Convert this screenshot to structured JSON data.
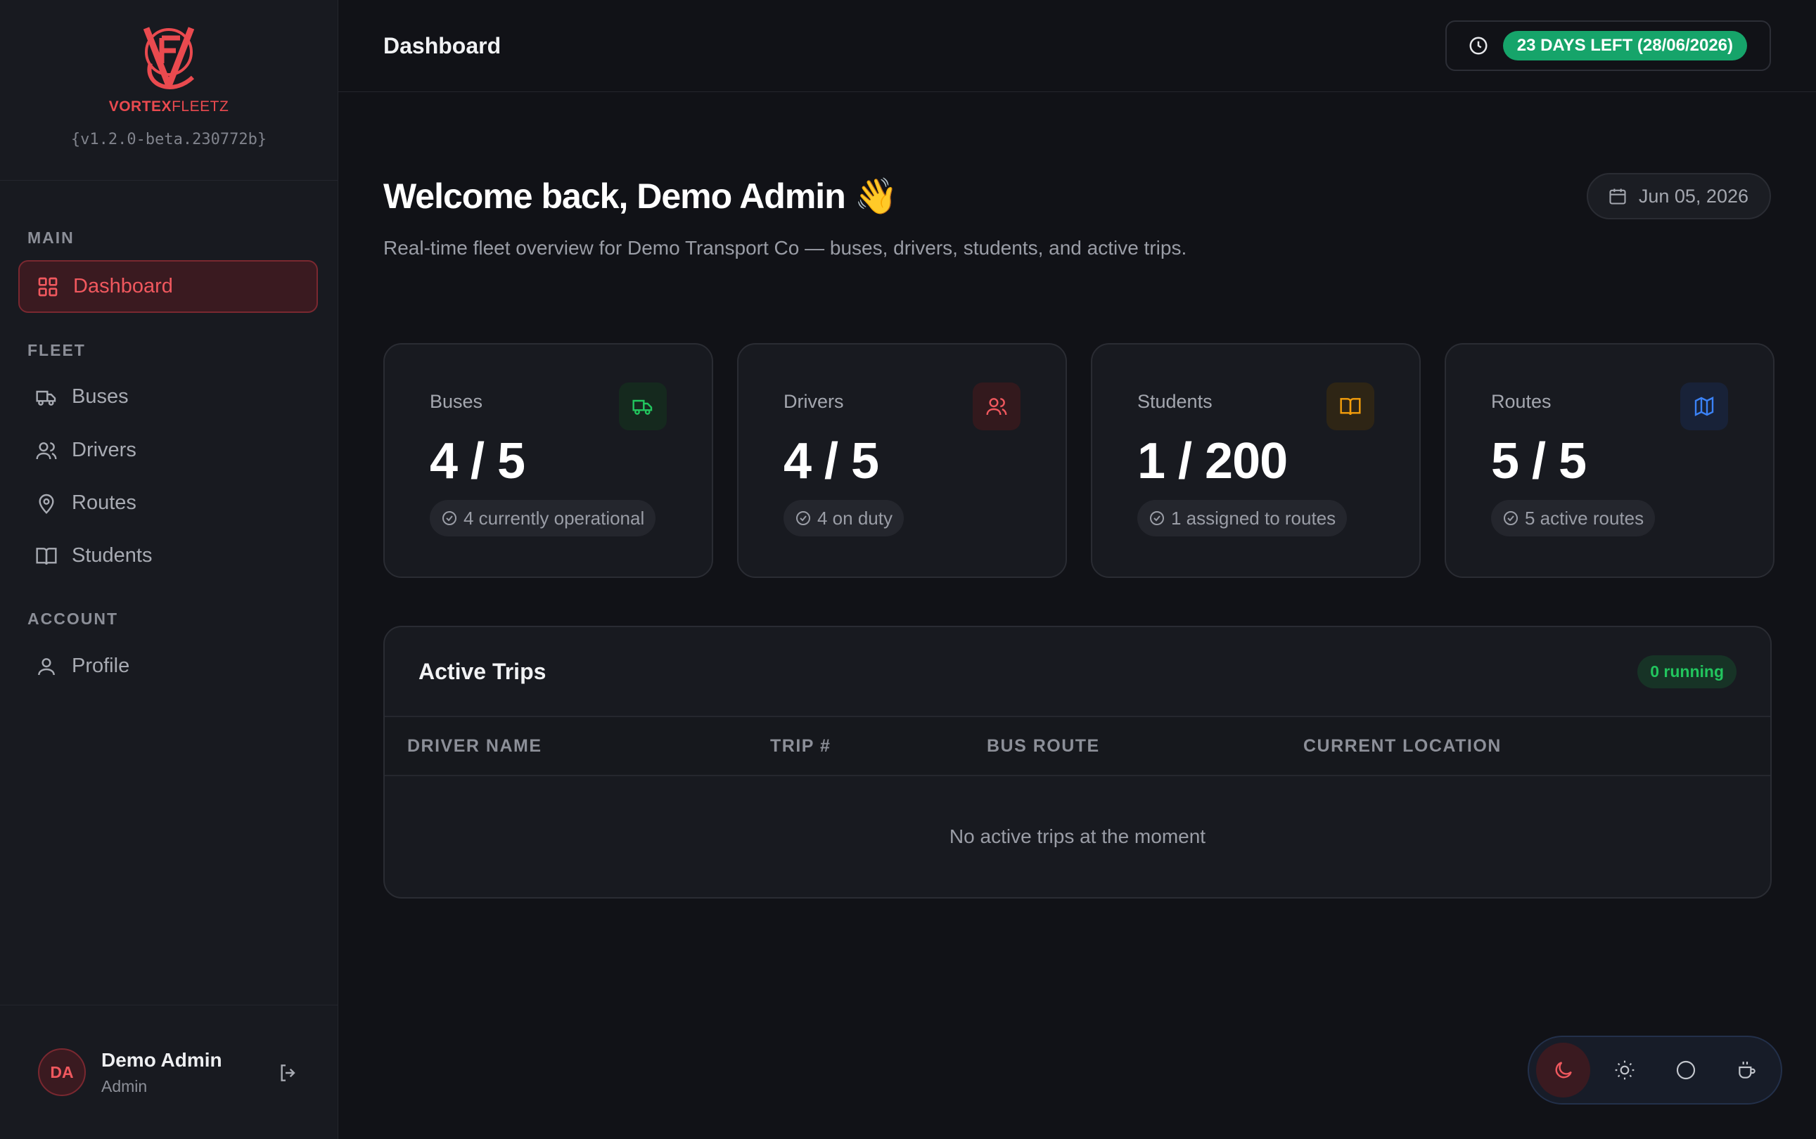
{
  "brand": {
    "name_bold": "VORTEX",
    "name_light": "FLEET",
    "suffix": "Z",
    "version": "{v1.2.0-beta.230772b}",
    "accent_color": "#ea4a4f"
  },
  "sidebar": {
    "sections": [
      {
        "title": "MAIN"
      },
      {
        "title": "FLEET"
      },
      {
        "title": "ACCOUNT"
      }
    ],
    "items": [
      {
        "label": "Dashboard",
        "icon": "grid-icon",
        "active": true
      },
      {
        "label": "Buses",
        "icon": "truck-icon"
      },
      {
        "label": "Drivers",
        "icon": "users-icon"
      },
      {
        "label": "Routes",
        "icon": "map-pin-icon"
      },
      {
        "label": "Students",
        "icon": "book-icon"
      },
      {
        "label": "Profile",
        "icon": "user-icon"
      }
    ]
  },
  "user": {
    "initials": "DA",
    "name": "Demo Admin",
    "role": "Admin"
  },
  "header": {
    "title": "Dashboard",
    "license_text": "23 DAYS LEFT (28/06/2026)",
    "license_color": "#16a46a"
  },
  "welcome": {
    "title": "Welcome back, Demo Admin 👋",
    "subtitle": "Real-time fleet overview for Demo Transport Co — buses, drivers, students, and active trips.",
    "date": "Jun 05, 2026"
  },
  "stats": [
    {
      "label": "Buses",
      "value": "4 / 5",
      "sub": "4 currently operational",
      "icon": "truck-icon",
      "color": "#22c55e"
    },
    {
      "label": "Drivers",
      "value": "4 / 5",
      "sub": "4 on duty",
      "icon": "users-icon",
      "color": "#f0585e"
    },
    {
      "label": "Students",
      "value": "1 / 200",
      "sub": "1 assigned to routes",
      "icon": "book-icon",
      "color": "#f59e0b"
    },
    {
      "label": "Routes",
      "value": "5 / 5",
      "sub": "5 active routes",
      "icon": "map-icon",
      "color": "#3b82f6"
    }
  ],
  "trips": {
    "title": "Active Trips",
    "badge": "0 running",
    "columns": [
      "DRIVER NAME",
      "TRIP #",
      "BUS ROUTE",
      "CURRENT LOCATION"
    ],
    "empty_text": "No active trips at the moment"
  },
  "theme_switch": {
    "options": [
      "moon-icon",
      "sun-icon",
      "circle-icon",
      "coffee-icon"
    ],
    "active": "moon-icon"
  }
}
